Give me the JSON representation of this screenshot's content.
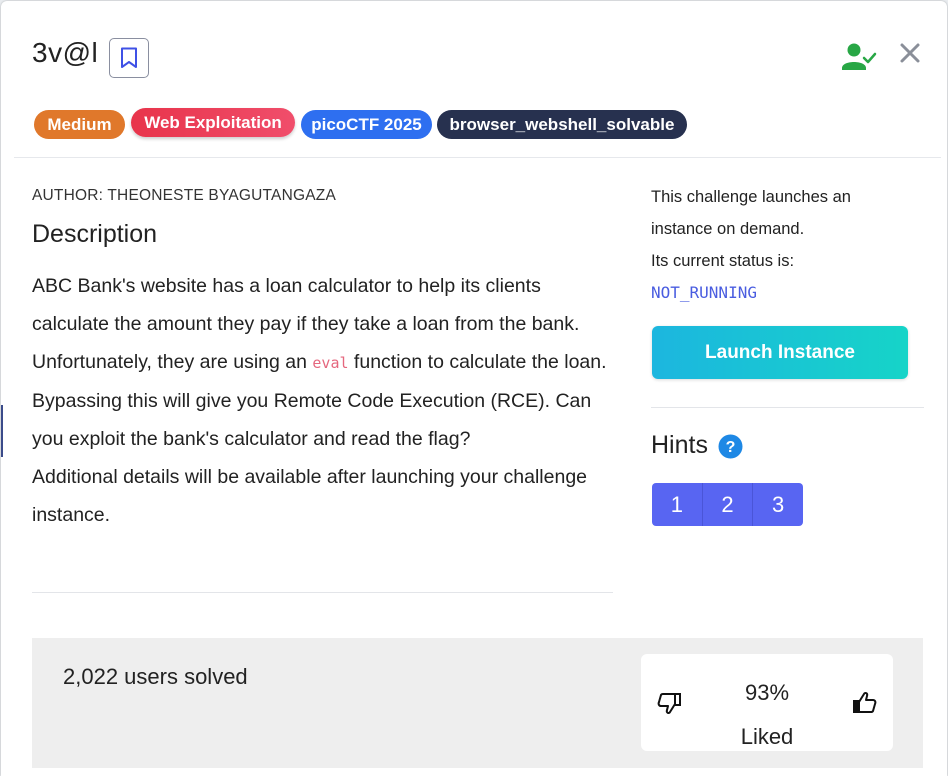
{
  "challenge": {
    "title": "3v@l",
    "tags": [
      "Medium",
      "Web Exploitation",
      "picoCTF 2025",
      "browser_webshell_solvable"
    ],
    "author": "AUTHOR: THEONESTE BYAGUTANGAZA",
    "description_heading": "Description",
    "description_part1": "ABC Bank's website has a loan calculator to help its clients calculate the amount they pay if they take a loan from the bank. Unfortunately, they are using an ",
    "description_code": "eval",
    "description_part2": " function to calculate the loan. Bypassing this will give you Remote Code Execution (RCE). Can you exploit the bank's calculator and read the flag?",
    "description_extra": "Additional details will be available after launching your challenge instance."
  },
  "instance": {
    "line1": "This challenge launches an instance on demand.",
    "line2": "Its current status is:",
    "status": "NOT_RUNNING",
    "launch_label": "Launch Instance"
  },
  "hints": {
    "label": "Hints",
    "buttons": [
      "1",
      "2",
      "3"
    ]
  },
  "footer": {
    "solved": "2,022 users solved",
    "liked_pct": "93%",
    "liked_label": "Liked"
  },
  "colors": {
    "medium": "#e0782b",
    "web": "#e8344b",
    "pico": "#2e6ff0",
    "browser": "#27314f",
    "launch": "#16d4c8",
    "hint": "#5865f2",
    "status": "#4a5de0",
    "solved_icon": "#28a745"
  },
  "icons": {
    "bookmark": "bookmark-icon",
    "user_check": "user-check-icon",
    "close": "close-icon",
    "help": "question-circle-icon",
    "thumb_down": "thumbs-down-icon",
    "thumb_up": "thumbs-up-icon"
  }
}
